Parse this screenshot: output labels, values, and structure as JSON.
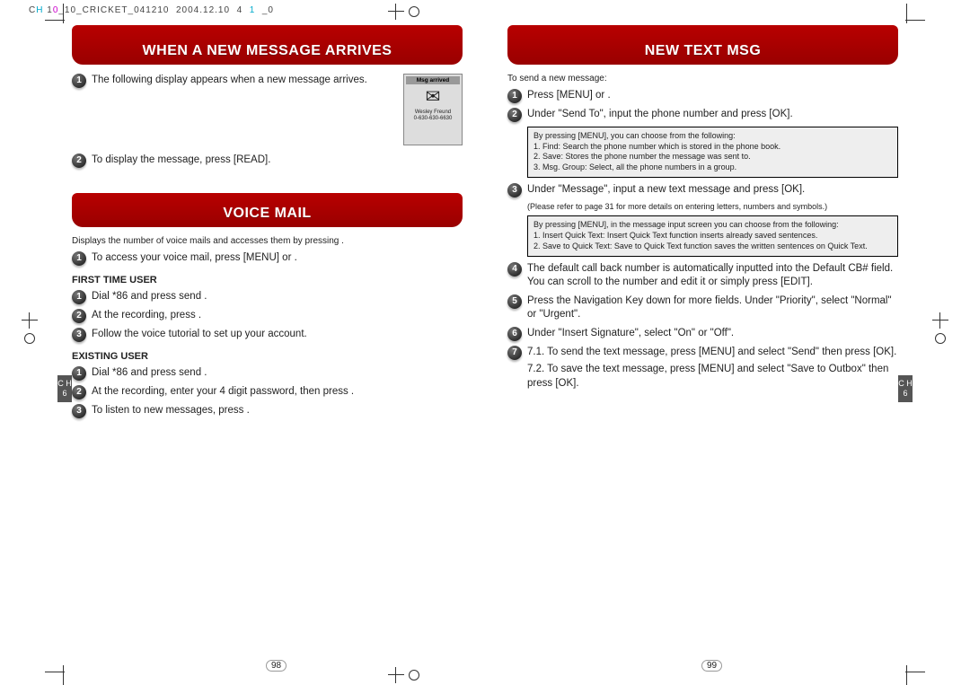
{
  "file_header": "CH 10_10_CRICKET_041210  2004.12.10  4  1  _0",
  "left": {
    "hdr1": "WHEN A NEW MESSAGE ARRIVES",
    "s1": "The following display appears when a new message arrives.",
    "screen_title": "Msg arrived",
    "screen_name": "Wesley Freund",
    "screen_number": "0-630-630-6630",
    "s2": "To display the message, press         [READ].",
    "hdr2": "VOICE MAIL",
    "vm_intro": "Displays the number of voice mails and accesses them by pressing        .",
    "vm1": "To access your voice mail, press        [MENU]                 or        .",
    "sub_first": "FIRST TIME USER",
    "f1": "Dial *86 and press send        .",
    "f2": "At the recording, press        .",
    "f3": "Follow the voice tutorial to set up your account.",
    "sub_exist": "EXISTING USER",
    "e1": "Dial *86 and press send        .",
    "e2": "At the recording, enter your 4 digit password, then press        .",
    "e3": "To listen to new messages, press        .",
    "page": "98"
  },
  "right": {
    "hdr": "NEW TEXT MSG",
    "intro": "To send a new message:",
    "s1": "Press        [MENU]                 or        .",
    "s2": "Under \"Send To\", input the phone number and press     [OK].",
    "box1_lead": "By pressing        [MENU], you can choose from the following:",
    "box1_1": "1. Find: Search the phone number which is stored in the phone book.",
    "box1_2": "2. Save: Stores the phone number the message was sent to.",
    "box1_3": "3. Msg. Group: Select, all the phone numbers in a group.",
    "s3": "Under \"Message\", input a new text message and press     [OK].",
    "s3_note": "(Please refer to page 31 for more details on entering letters, numbers and symbols.)",
    "box2_lead": "By pressing        [MENU], in the message input screen you can choose from the following:",
    "box2_1": "1. Insert Quick Text: Insert Quick Text function inserts already saved sentences.",
    "box2_2": "2. Save to Quick Text: Save to Quick Text function saves the written sentences on Quick Text.",
    "s4": "The default call back number is automatically inputted into the Default CB# field. You can scroll to the number and edit it or simply press     [EDIT].",
    "s5": "Press the Navigation Key down for more fields. Under \"Priority\", select \"Normal\" or \"Urgent\".",
    "s6": "Under \"Insert Signature\", select \"On\" or \"Off\".",
    "s7a": "7.1. To send the text message, press       [MENU] and select \"Send\" then press     [OK].",
    "s7b": "7.2. To save the text message, press       [MENU] and select \"Save to Outbox\" then press     [OK].",
    "page": "99"
  },
  "side_tab": "C\nH\n6"
}
